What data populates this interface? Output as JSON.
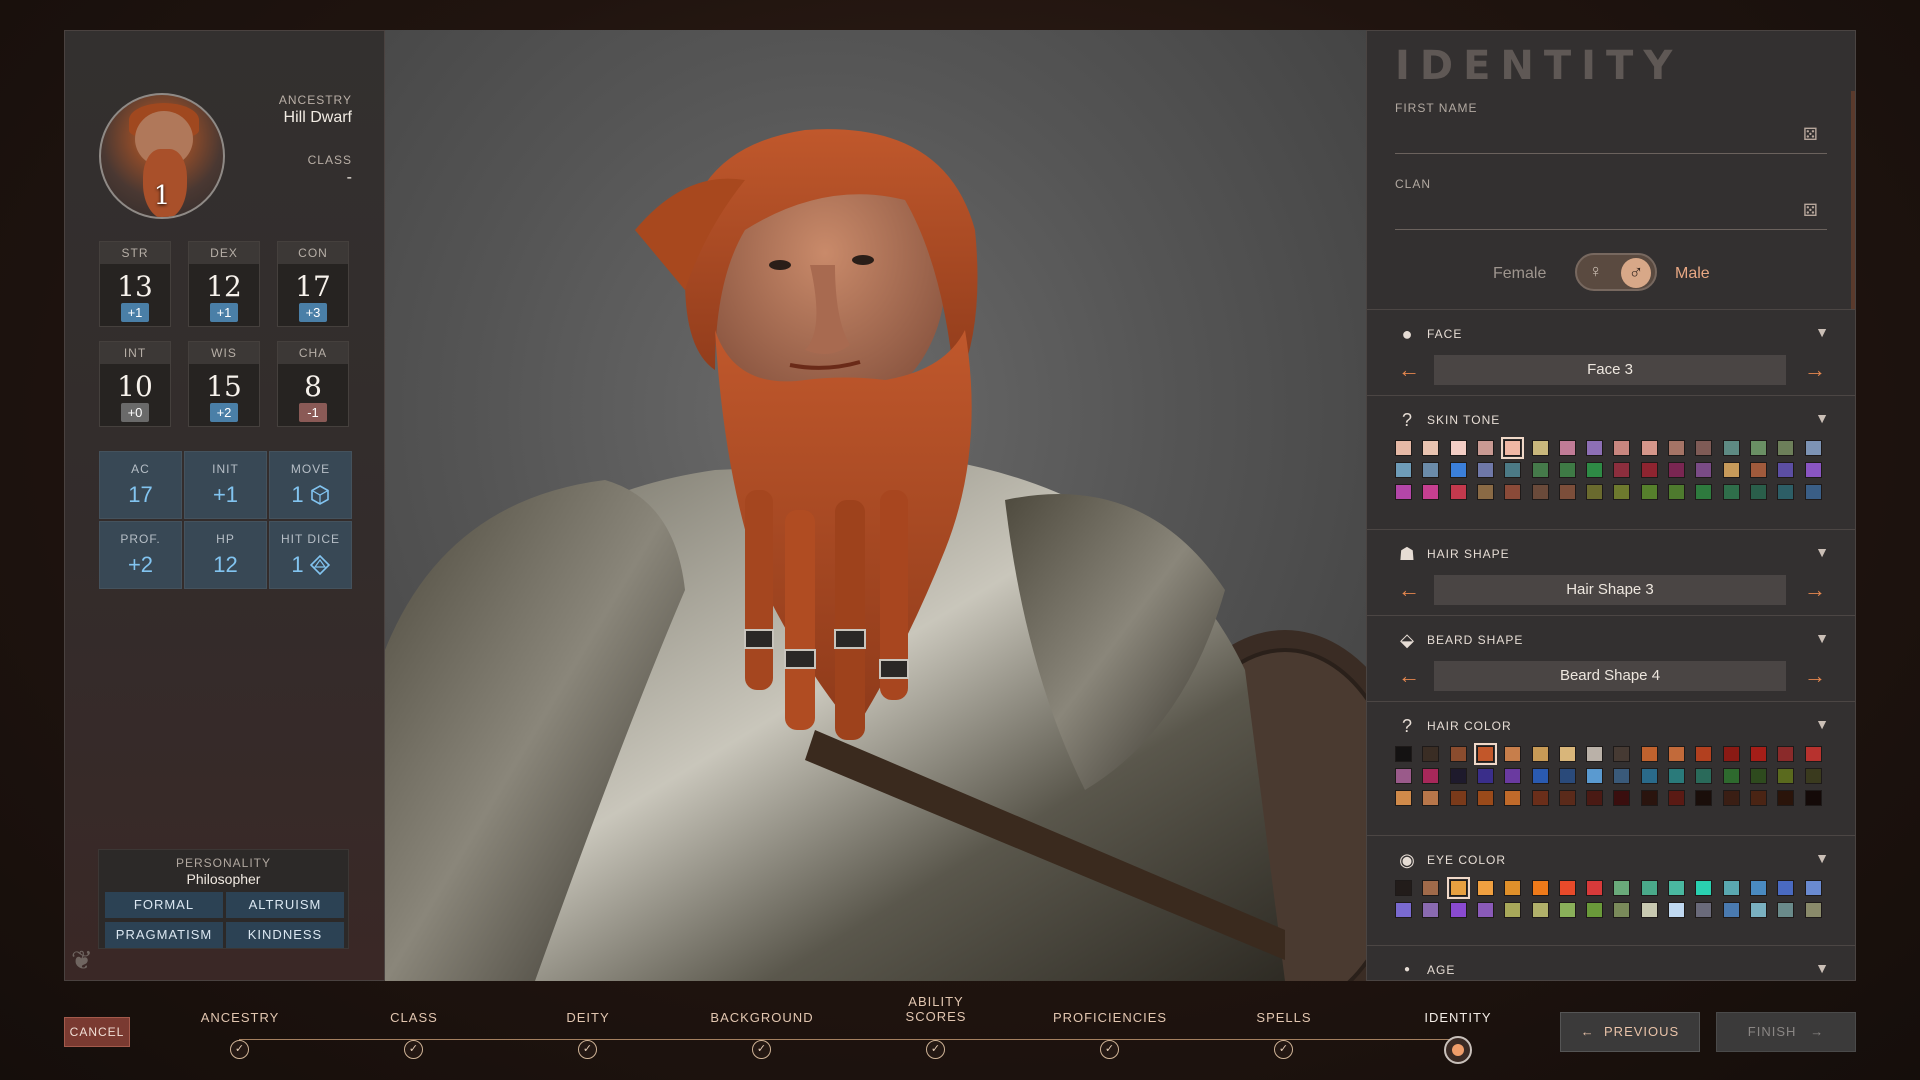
{
  "character": {
    "level": "1",
    "ancestry_label": "ANCESTRY",
    "ancestry": "Hill Dwarf",
    "class_label": "CLASS",
    "class": "-"
  },
  "abilities": [
    {
      "label": "STR",
      "value": "13",
      "mod": "+1",
      "mod_type": "pos"
    },
    {
      "label": "DEX",
      "value": "12",
      "mod": "+1",
      "mod_type": "pos"
    },
    {
      "label": "CON",
      "value": "17",
      "mod": "+3",
      "mod_type": "pos"
    },
    {
      "label": "INT",
      "value": "10",
      "mod": "+0",
      "mod_type": "zero"
    },
    {
      "label": "WIS",
      "value": "15",
      "mod": "+2",
      "mod_type": "pos"
    },
    {
      "label": "CHA",
      "value": "8",
      "mod": "-1",
      "mod_type": "neg"
    }
  ],
  "derived": [
    {
      "label": "AC",
      "value": "17"
    },
    {
      "label": "INIT",
      "value": "+1"
    },
    {
      "label": "MOVE",
      "value": "1",
      "icon": "hex-die-icon"
    },
    {
      "label": "PROF.",
      "value": "+2"
    },
    {
      "label": "HP",
      "value": "12"
    },
    {
      "label": "HIT DICE",
      "value": "1",
      "icon": "d8-die-icon"
    }
  ],
  "personality": {
    "label": "PERSONALITY",
    "value": "Philosopher",
    "traits": [
      "FORMAL",
      "ALTRUISM",
      "PRAGMATISM",
      "KINDNESS"
    ]
  },
  "identity": {
    "title": "IDENTITY",
    "first_name_label": "FIRST NAME",
    "first_name_value": "",
    "clan_label": "CLAN",
    "clan_value": "",
    "female_label": "Female",
    "male_label": "Male",
    "selected_gender": "Male"
  },
  "sections": {
    "face": {
      "title": "FACE",
      "value": "Face 3",
      "icon": "face-icon"
    },
    "skin_tone": {
      "title": "SKIN TONE",
      "icon": "question-icon"
    },
    "hair_shape": {
      "title": "HAIR SHAPE",
      "value": "Hair Shape 3",
      "icon": "hair-icon"
    },
    "beard_shape": {
      "title": "BEARD SHAPE",
      "value": "Beard Shape 4",
      "icon": "beard-icon"
    },
    "hair_color": {
      "title": "HAIR COLOR",
      "icon": "question-icon"
    },
    "eye_color": {
      "title": "EYE COLOR",
      "icon": "eye-icon"
    },
    "age": {
      "title": "AGE",
      "icon": "dot-icon"
    }
  },
  "palettes": {
    "skin_tone": [
      [
        "#e6b9a6",
        "#e9c3b0",
        "#f3cdc4",
        "#c99a93",
        "#f0b7a4",
        "#c9b77c",
        "#c07b96",
        "#8d6fb5",
        "#c9867f",
        "#d5968a",
        "#a57466",
        "#7f5b56",
        "#5e8a83",
        "#6a8f64",
        "#6d7f5a",
        "#7d93b4"
      ],
      [
        "#6e9cb8",
        "#6b8ba9",
        "#3b7fd9",
        "#6f78a8",
        "#4c7a86",
        "#457a4a",
        "#3e7a45",
        "#2e8a45",
        "#8c2e3d",
        "#8e2430",
        "#7a2652",
        "#7a4b86",
        "#c79a5a",
        "#a05a3c",
        "#5c4ea3",
        "#8a55c2"
      ],
      [
        "#b346a8",
        "#c63f90",
        "#c4394d",
        "#8a6a45",
        "#8a4a38",
        "#6a4a3a",
        "#7c4e3a",
        "#6a6a2e",
        "#6e7a2e",
        "#56802c",
        "#4e7a2e",
        "#2e7a3e",
        "#2f6e4a",
        "#2a5e4a",
        "#2d5e66",
        "#3a5e86"
      ]
    ],
    "hair_color": [
      [
        "#141212",
        "#3a2d24",
        "#8a4c2e",
        "#c2572a",
        "#c77e4b",
        "#c79a56",
        "#d9b67a",
        "#bab1a8",
        "#463a33",
        "#c0622e",
        "#c26a3a",
        "#b2401f",
        "#8a1a14",
        "#a41e18",
        "#8a2a2a",
        "#b7322e"
      ],
      [
        "#9a5a8a",
        "#a8285a",
        "#1e1a2c",
        "#3a2e8a",
        "#6a3aa0",
        "#2a5ab0",
        "#2a4a7a",
        "#5a9ad0",
        "#3a5a7a",
        "#2a6a8a",
        "#2a7a7a",
        "#2a6a5a",
        "#2e6a2e",
        "#2e4a1e",
        "#5a6a1e",
        "#3a3a1e"
      ],
      [
        "#d08a4a",
        "#b8764a",
        "#7a3a1a",
        "#9a4a1a",
        "#c06a2a",
        "#6a2e1a",
        "#5a2a1a",
        "#4a1a14",
        "#3a0e0e",
        "#2a140e",
        "#5a1a14",
        "#1a0e0a",
        "#3a1e14",
        "#4a2414",
        "#2a140a",
        "#140a08"
      ]
    ],
    "eye_color": [
      [
        "#221c1a",
        "#a06a4a",
        "#e8a040",
        "#f0a040",
        "#e0902a",
        "#ee7a1a",
        "#e84a2a",
        "#d83a3a",
        "#6aaa7a",
        "#4aaa8a",
        "#4ab8a0",
        "#2ad0b0",
        "#5aa8b0",
        "#4a8ac0",
        "#4a6ac0",
        "#6a8ad0"
      ],
      [
        "#7a6ad0",
        "#8a6ab0",
        "#8a4ad0",
        "#8a5ab8",
        "#a8a85a",
        "#b0b06a",
        "#8ab05a",
        "#6a9a3a",
        "#7a8a5a",
        "#c8c8b0",
        "#c0d8f0",
        "#6a6a7a",
        "#4a7ab0",
        "#7ab0c0",
        "#6a8a8a",
        "#8a8a6a"
      ]
    ]
  },
  "selected_swatches": {
    "skin_tone": [
      0,
      4
    ],
    "hair_color": [
      0,
      3
    ],
    "eye_color": [
      0,
      2
    ]
  },
  "nav": {
    "cancel": "CANCEL",
    "steps": [
      "ANCESTRY",
      "CLASS",
      "DEITY",
      "BACKGROUND",
      "ABILITY SCORES",
      "PROFICIENCIES",
      "SPELLS",
      "IDENTITY"
    ],
    "active_step": "IDENTITY",
    "previous": "PREVIOUS",
    "finish": "FINISH"
  },
  "colors": {
    "accent": "#e5874e",
    "modifier_positive": "#4a7fa7",
    "modifier_negative": "#8a5a56",
    "derived_value": "#82c4f0",
    "trait_bg": "#2c4254"
  }
}
